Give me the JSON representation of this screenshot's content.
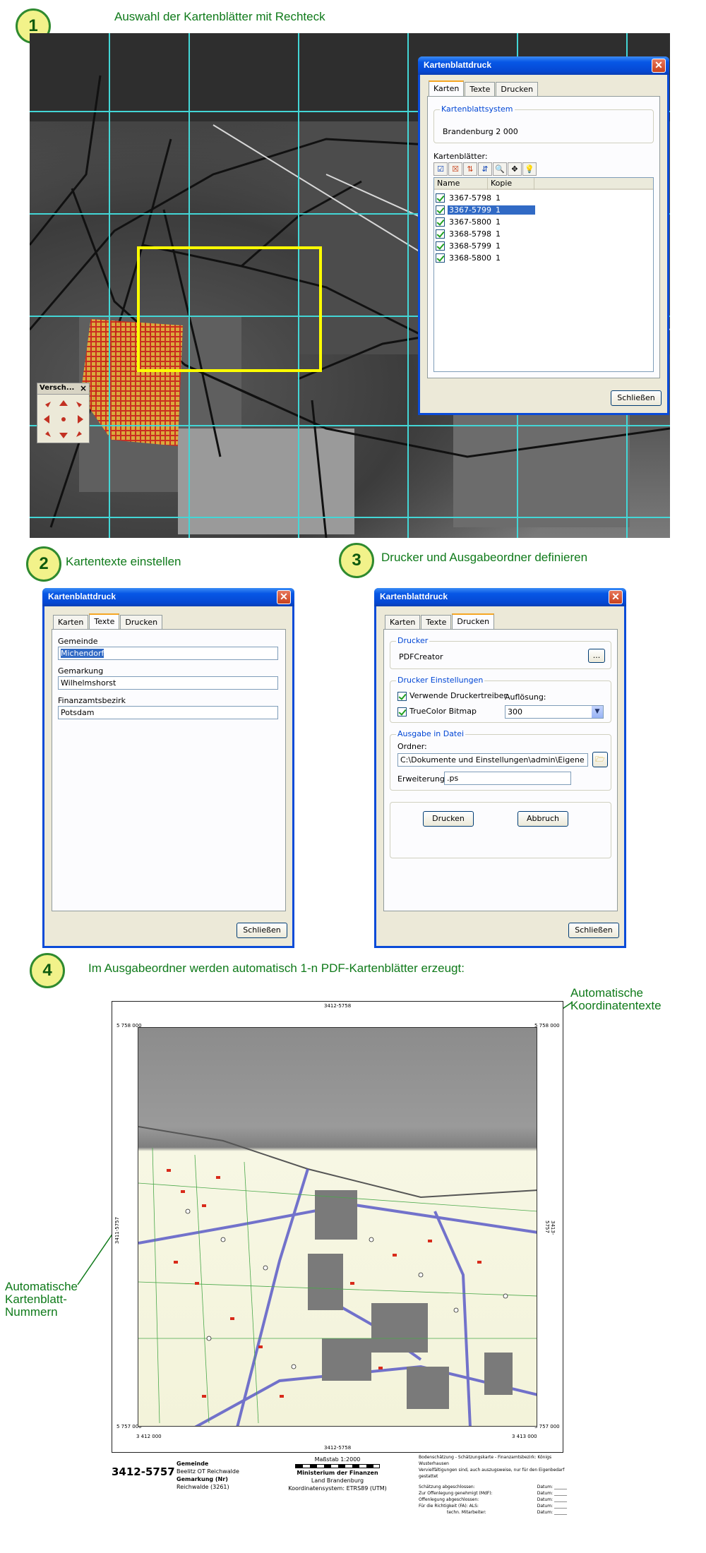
{
  "colors": {
    "caption_green": "#0f7a1a",
    "step_circle_fill": "#f2f28a",
    "xp_title_blue": "#0548d3",
    "grid_cyan": "#43d6d6",
    "selection_rect_yellow": "#ffff00",
    "selection_blue": "#316ac5",
    "parcel_red": "#d82a1a"
  },
  "steps": [
    {
      "number": "1",
      "caption": "Auswahl der Kartenblätter mit Rechteck"
    },
    {
      "number": "2",
      "caption": "Kartentexte einstellen"
    },
    {
      "number": "3",
      "caption": "Drucker und Ausgabeordner definieren"
    },
    {
      "number": "4",
      "caption": "Im Ausgabeordner werden automatisch 1-n PDF-Kartenblätter erzeugt:"
    }
  ],
  "move_window": {
    "title": "Versch...",
    "close_icon": "×"
  },
  "dialog1": {
    "title": "Kartenblattdruck",
    "tabs": [
      "Karten",
      "Texte",
      "Drucken"
    ],
    "active_tab": "Karten",
    "group_label": "Kartenblattsystem",
    "system_value": "Brandenburg 2 000",
    "list_label": "Kartenblätter:",
    "toolbar_icons": [
      "check-all-icon",
      "uncheck-all-icon",
      "sort-ascending-icon",
      "sort-descending-icon",
      "zoom-icon",
      "center-icon",
      "lightbulb-icon"
    ],
    "columns": [
      "Name",
      "Kopie"
    ],
    "rows": [
      {
        "name": "3367-5798",
        "kopie": "1",
        "selected": false
      },
      {
        "name": "3367-5799",
        "kopie": "1",
        "selected": true
      },
      {
        "name": "3367-5800",
        "kopie": "1",
        "selected": false
      },
      {
        "name": "3368-5798",
        "kopie": "1",
        "selected": false
      },
      {
        "name": "3368-5799",
        "kopie": "1",
        "selected": false
      },
      {
        "name": "3368-5800",
        "kopie": "1",
        "selected": false
      }
    ],
    "close_button": "Schließen"
  },
  "dialog2": {
    "title": "Kartenblattdruck",
    "tabs": [
      "Karten",
      "Texte",
      "Drucken"
    ],
    "active_tab": "Texte",
    "fields": [
      {
        "label": "Gemeinde",
        "value": "Michendorf"
      },
      {
        "label": "Gemarkung",
        "value": "Wilhelmshorst"
      },
      {
        "label": "Finanzamtsbezirk",
        "value": "Potsdam"
      }
    ],
    "close_button": "Schließen"
  },
  "dialog3": {
    "title": "Kartenblattdruck",
    "tabs": [
      "Karten",
      "Texte",
      "Drucken"
    ],
    "active_tab": "Drucken",
    "printer_group": "Drucker",
    "printer_value": "PDFCreator",
    "browse_button": "...",
    "settings_group": "Drucker Einstellungen",
    "checkbox1": "Verwende Druckertreiber",
    "checkbox2": "TrueColor Bitmap",
    "resolution_label": "Auflösung:",
    "resolution_value": "300",
    "output_group": "Ausgabe in Datei",
    "folder_label": "Ordner:",
    "folder_value": "C:\\Dokumente und Einstellungen\\admin\\Eigene D",
    "extension_label": "Erweiterung:",
    "extension_value": ".ps",
    "print_button": "Drucken",
    "cancel_button": "Abbruch",
    "close_button": "Schließen"
  },
  "annotations": {
    "coord_texts": "Automatische Koordinatentexte",
    "sheet_numbers": "Automatische Kartenblatt-Nummern"
  },
  "pdf_sheet": {
    "top_number": "3412-5758",
    "bottom_number": "3412-5758",
    "left_number": "3411-5757",
    "right_number": "3413-5757",
    "corner_tl": "5 758 000",
    "corner_tr": "5 758 000",
    "corner_bl": "5 757 000",
    "corner_br": "5 757 000",
    "corner_x_left": "3 412 000",
    "corner_x_right": "3 413 000",
    "sheet_id": "3412-5757",
    "info_lines": [
      "Gemeinde",
      "Beelitz OT Reichwalde",
      "Gemarkung (Nr)",
      "Reichwalde (3261)"
    ],
    "scale": "Maßstab 1:2000",
    "ministry": "Ministerium der Finanzen",
    "state": "Land Brandenburg",
    "crs": "Koordinatensystem: ETRS89 (UTM)",
    "right_block": [
      "Bodenschätzung - Schätzungskarte - Finanzamtsbezirk: Königs Wusterhausen",
      "Vervielfältigungen sind, auch auszugsweise, nur für den Eigenbedarf gestattet",
      "Schätzung abgeschlossen:",
      "Zur Offenlegung genehmigt (MdF):",
      "Offenlegung abgeschlossen:",
      "Für die Richtigkeit (FA):  ALS:",
      "techn. Mitarbeiter:"
    ],
    "date_label": "Datum:"
  }
}
